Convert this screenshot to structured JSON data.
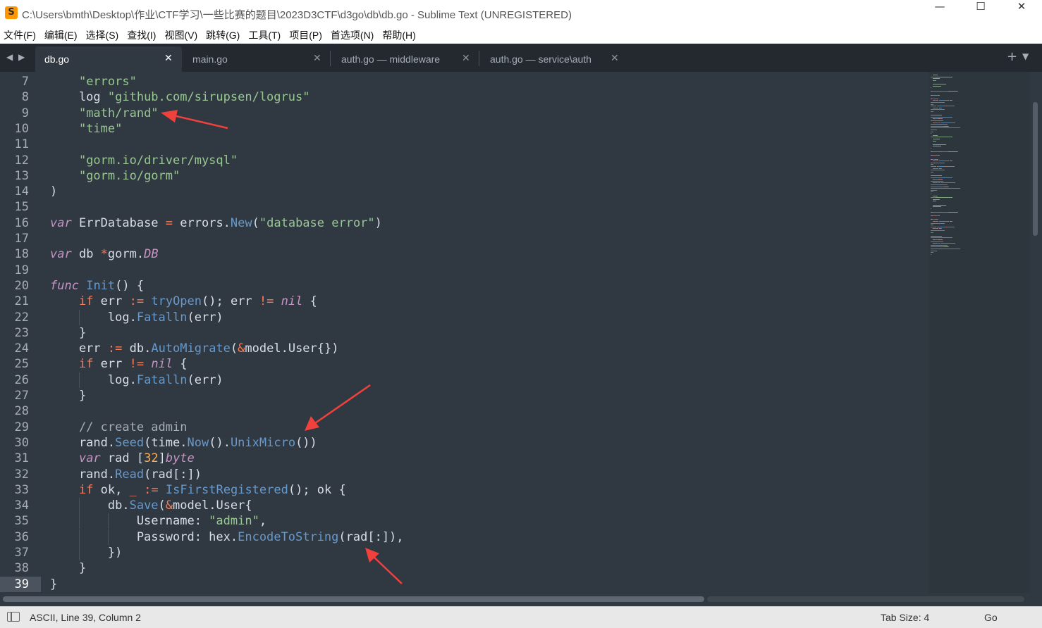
{
  "window": {
    "title": "C:\\Users\\bmth\\Desktop\\作业\\CTF学习\\一些比赛的题目\\2023D3CTF\\d3go\\db\\db.go - Sublime Text (UNREGISTERED)",
    "logo_glyph": "S",
    "minimize": "—",
    "maximize": "☐",
    "close": "✕"
  },
  "menu": [
    "文件(F)",
    "编辑(E)",
    "选择(S)",
    "查找(I)",
    "视图(V)",
    "跳转(G)",
    "工具(T)",
    "项目(P)",
    "首选项(N)",
    "帮助(H)"
  ],
  "tabs": [
    {
      "label": "db.go",
      "active": true
    },
    {
      "label": "main.go",
      "active": false
    },
    {
      "label": "auth.go — middleware",
      "active": false
    },
    {
      "label": "auth.go — service\\auth",
      "active": false
    }
  ],
  "tab_controls": {
    "nav_left": "◀",
    "nav_right": "▶",
    "close": "✕",
    "new_tab": "+",
    "dropdown": "▼"
  },
  "editor": {
    "current_line": 39,
    "lines": [
      {
        "n": "7",
        "tokens": [
          [
            "    ",
            "txt"
          ],
          [
            "\"errors\"",
            "str"
          ]
        ]
      },
      {
        "n": "8",
        "tokens": [
          [
            "    log ",
            "txt"
          ],
          [
            "\"github.com/sirupsen/logrus\"",
            "str"
          ]
        ]
      },
      {
        "n": "9",
        "tokens": [
          [
            "    ",
            "txt"
          ],
          [
            "\"math/rand\"",
            "str"
          ]
        ]
      },
      {
        "n": "10",
        "tokens": [
          [
            "    ",
            "txt"
          ],
          [
            "\"time\"",
            "str"
          ]
        ]
      },
      {
        "n": "11",
        "tokens": []
      },
      {
        "n": "12",
        "tokens": [
          [
            "    ",
            "txt"
          ],
          [
            "\"gorm.io/driver/mysql\"",
            "str"
          ]
        ]
      },
      {
        "n": "13",
        "tokens": [
          [
            "    ",
            "txt"
          ],
          [
            "\"gorm.io/gorm\"",
            "str"
          ]
        ]
      },
      {
        "n": "14",
        "tokens": [
          [
            ")",
            "txt"
          ]
        ]
      },
      {
        "n": "15",
        "tokens": []
      },
      {
        "n": "16",
        "tokens": [
          [
            "var",
            "kw"
          ],
          [
            " ErrDatabase ",
            "txt"
          ],
          [
            "=",
            "op"
          ],
          [
            " errors.",
            "txt"
          ],
          [
            "New",
            "fn"
          ],
          [
            "(",
            "txt"
          ],
          [
            "\"database error\"",
            "str"
          ],
          [
            ")",
            "txt"
          ]
        ]
      },
      {
        "n": "17",
        "tokens": []
      },
      {
        "n": "18",
        "tokens": [
          [
            "var",
            "kw"
          ],
          [
            " db ",
            "txt"
          ],
          [
            "*",
            "op"
          ],
          [
            "gorm.",
            "txt"
          ],
          [
            "DB",
            "type"
          ]
        ]
      },
      {
        "n": "19",
        "tokens": []
      },
      {
        "n": "20",
        "tokens": [
          [
            "func",
            "kw"
          ],
          [
            " ",
            "txt"
          ],
          [
            "Init",
            "fn"
          ],
          [
            "() {",
            "txt"
          ]
        ]
      },
      {
        "n": "21",
        "tokens": [
          [
            "    ",
            "txt"
          ],
          [
            "if",
            "op"
          ],
          [
            " err ",
            "txt"
          ],
          [
            ":=",
            "op"
          ],
          [
            " ",
            "txt"
          ],
          [
            "tryOpen",
            "fn"
          ],
          [
            "(); err ",
            "txt"
          ],
          [
            "!=",
            "op"
          ],
          [
            " ",
            "txt"
          ],
          [
            "nil",
            "kw"
          ],
          [
            " {",
            "txt"
          ]
        ]
      },
      {
        "n": "22",
        "tokens": [
          [
            "        log.",
            "txt"
          ],
          [
            "Fatalln",
            "fn"
          ],
          [
            "(err)",
            "txt"
          ]
        ]
      },
      {
        "n": "23",
        "tokens": [
          [
            "    }",
            "txt"
          ]
        ]
      },
      {
        "n": "24",
        "tokens": [
          [
            "    err ",
            "txt"
          ],
          [
            ":=",
            "op"
          ],
          [
            " db.",
            "txt"
          ],
          [
            "AutoMigrate",
            "fn"
          ],
          [
            "(",
            "txt"
          ],
          [
            "&",
            "op"
          ],
          [
            "model.User{})",
            "txt"
          ]
        ]
      },
      {
        "n": "25",
        "tokens": [
          [
            "    ",
            "txt"
          ],
          [
            "if",
            "op"
          ],
          [
            " err ",
            "txt"
          ],
          [
            "!=",
            "op"
          ],
          [
            " ",
            "txt"
          ],
          [
            "nil",
            "kw"
          ],
          [
            " {",
            "txt"
          ]
        ]
      },
      {
        "n": "26",
        "tokens": [
          [
            "        log.",
            "txt"
          ],
          [
            "Fatalln",
            "fn"
          ],
          [
            "(err)",
            "txt"
          ]
        ]
      },
      {
        "n": "27",
        "tokens": [
          [
            "    }",
            "txt"
          ]
        ]
      },
      {
        "n": "28",
        "tokens": []
      },
      {
        "n": "29",
        "tokens": [
          [
            "    // create admin",
            "cm"
          ]
        ]
      },
      {
        "n": "30",
        "tokens": [
          [
            "    rand.",
            "txt"
          ],
          [
            "Seed",
            "fn"
          ],
          [
            "(time.",
            "txt"
          ],
          [
            "Now",
            "fn"
          ],
          [
            "().",
            "txt"
          ],
          [
            "UnixMicro",
            "fn"
          ],
          [
            "())",
            "txt"
          ]
        ]
      },
      {
        "n": "31",
        "tokens": [
          [
            "    ",
            "txt"
          ],
          [
            "var",
            "kw"
          ],
          [
            " rad [",
            "txt"
          ],
          [
            "32",
            "num"
          ],
          [
            "]",
            "txt"
          ],
          [
            "byte",
            "type"
          ]
        ]
      },
      {
        "n": "32",
        "tokens": [
          [
            "    rand.",
            "txt"
          ],
          [
            "Read",
            "fn"
          ],
          [
            "(rad[:])",
            "txt"
          ]
        ]
      },
      {
        "n": "33",
        "tokens": [
          [
            "    ",
            "txt"
          ],
          [
            "if",
            "op"
          ],
          [
            " ok, ",
            "txt"
          ],
          [
            "_",
            "op"
          ],
          [
            " ",
            "txt"
          ],
          [
            ":=",
            "op"
          ],
          [
            " ",
            "txt"
          ],
          [
            "IsFirstRegistered",
            "fn"
          ],
          [
            "(); ok {",
            "txt"
          ]
        ]
      },
      {
        "n": "34",
        "tokens": [
          [
            "        db.",
            "txt"
          ],
          [
            "Save",
            "fn"
          ],
          [
            "(",
            "txt"
          ],
          [
            "&",
            "op"
          ],
          [
            "model.User{",
            "txt"
          ]
        ]
      },
      {
        "n": "35",
        "tokens": [
          [
            "            Username: ",
            "txt"
          ],
          [
            "\"admin\"",
            "str"
          ],
          [
            ",",
            "txt"
          ]
        ]
      },
      {
        "n": "36",
        "tokens": [
          [
            "            Password: hex.",
            "txt"
          ],
          [
            "EncodeToString",
            "fn"
          ],
          [
            "(rad[:]),",
            "txt"
          ]
        ]
      },
      {
        "n": "37",
        "tokens": [
          [
            "        })",
            "txt"
          ]
        ]
      },
      {
        "n": "38",
        "tokens": [
          [
            "    }",
            "txt"
          ]
        ]
      },
      {
        "n": "39",
        "tokens": [
          [
            "}",
            "txt"
          ]
        ]
      }
    ]
  },
  "colors": {
    "background": "#303841",
    "string": "#99c794",
    "keyword": "#c594c5",
    "function": "#6699cc",
    "operator": "#f97b58",
    "number": "#f9ae58",
    "comment": "#a6acb9",
    "text": "#d8dee9",
    "annotation_arrow": "#f0413d"
  },
  "status": {
    "text": "ASCII, Line 39, Column 2",
    "tab_size": "Tab Size: 4",
    "syntax": "Go"
  }
}
